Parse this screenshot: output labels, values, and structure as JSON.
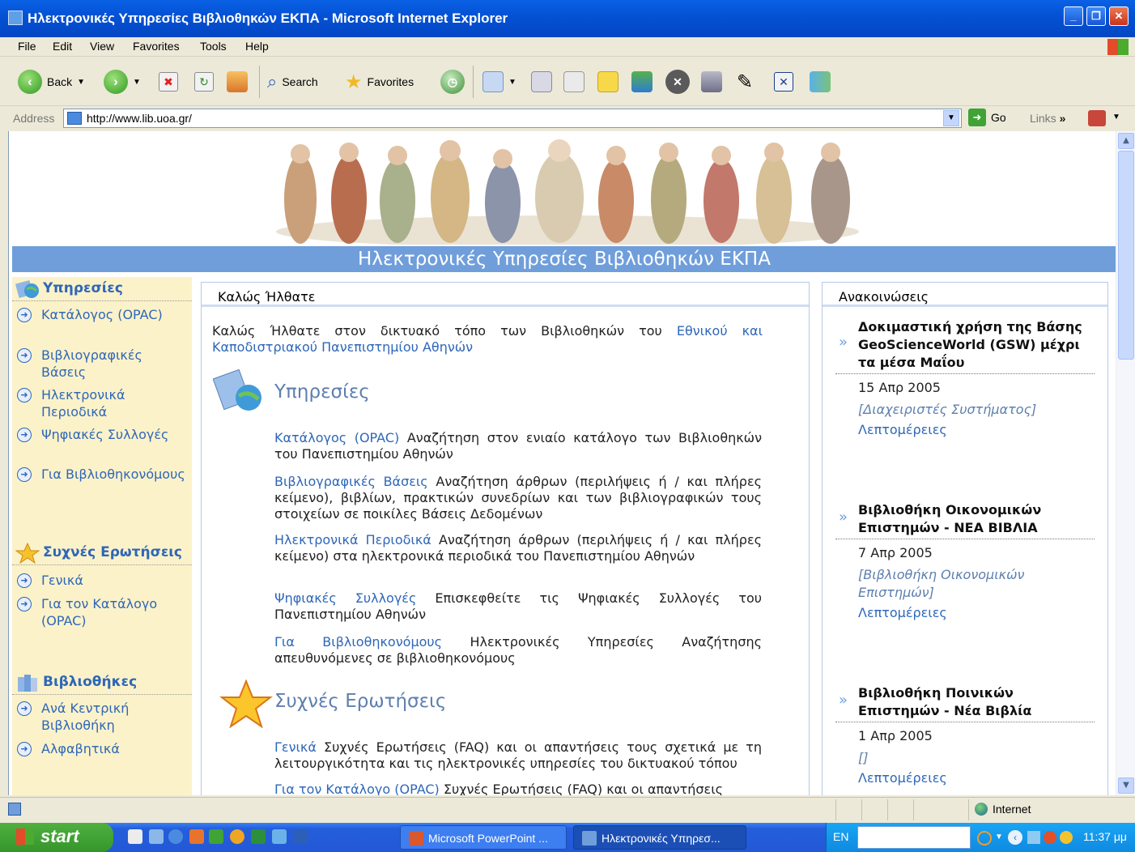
{
  "window": {
    "title": "Ηλεκτρονικές Υπηρεσίες Βιβλιοθηκών ΕΚΠΑ - Microsoft Internet Explorer"
  },
  "menu": [
    "File",
    "Edit",
    "View",
    "Favorites",
    "Tools",
    "Help"
  ],
  "toolbar": {
    "back": "Back",
    "search": "Search",
    "favorites": "Favorites"
  },
  "address": {
    "label": "Address",
    "url": "http://www.lib.uoa.gr/",
    "go": "Go",
    "links": "Links"
  },
  "page": {
    "banner_title": "Ηλεκτρονικές Υπηρεσίες Βιβλιοθηκών ΕΚΠΑ",
    "left_nav": {
      "sections": [
        {
          "title": "Υπηρεσίες",
          "icon": "globe-icon",
          "items": [
            "Κατάλογος (OPAC)",
            "Βιβλιογραφικές Βάσεις",
            "Ηλεκτρονικά Περιοδικά",
            "Ψηφιακές Συλλογές",
            "Για Βιβλιοθηκονόμους"
          ]
        },
        {
          "title": "Συχνές Ερωτήσεις",
          "icon": "star-icon",
          "items": [
            "Γενικά",
            "Για τον Κατάλογο (OPAC)"
          ]
        },
        {
          "title": "Βιβλιοθήκες",
          "icon": "books-icon",
          "items": [
            "Ανά Κεντρική Βιβλιοθήκη",
            "Αλφαβητικά"
          ]
        }
      ]
    },
    "main": {
      "header": "Καλώς Ήλθατε",
      "welcome_prefix": "Καλώς Ήλθατε στον δικτυακό τόπο των Βιβλιοθηκών του ",
      "welcome_link": "Εθνικού και Καποδιστριακού Πανεπιστημίου Αθηνών",
      "services_heading": "Υπηρεσίες",
      "services": [
        {
          "link": "Κατάλογος (OPAC)",
          "text": " Αναζήτηση στον ενιαίο κατάλογο των Βιβλιοθηκών του Πανεπιστημίου Αθηνών"
        },
        {
          "link": "Βιβλιογραφικές Βάσεις",
          "text": " Αναζήτηση άρθρων (περιλήψεις ή / και πλήρες κείμενο), βιβλίων, πρακτικών συνεδρίων και των βιβλιογραφικών τους στοιχείων σε ποικίλες Βάσεις Δεδομένων"
        },
        {
          "link": "Ηλεκτρονικά Περιοδικά",
          "text": " Αναζήτηση άρθρων (περιλήψεις ή / και πλήρες κείμενο) στα ηλεκτρονικά περιοδικά του Πανεπιστημίου Αθηνών"
        },
        {
          "link": "Ψηφιακές Συλλογές",
          "text": " Επισκεφθείτε τις Ψηφιακές Συλλογές του Πανεπιστημίου Αθηνών"
        },
        {
          "link": "Για Βιβλιοθηκονόμους",
          "text": " Ηλεκτρονικές Υπηρεσίες Αναζήτησης απευθυνόμενες σε βιβλιοθηκονόμους"
        }
      ],
      "faq_heading": "Συχνές Ερωτήσεις",
      "faq": [
        {
          "link": "Γενικά",
          "text": " Συχνές Ερωτήσεις (FAQ) και οι απαντήσεις τους σχετικά με τη λειτουργικότητα και τις ηλεκτρονικές υπηρεσίες του δικτυακού τόπου"
        },
        {
          "link": "Για τον Κατάλογο (OPAC)",
          "text": " Συχνές Ερωτήσεις (FAQ) και οι απαντήσεις"
        }
      ]
    },
    "announcements": {
      "header": "Ανακοινώσεις",
      "items": [
        {
          "title": "Δοκιμαστική χρήση της Βάσης GeoScienceWorld (GSW) μέχρι τα μέσα Μαΐου",
          "date": "15 Απρ 2005",
          "source": "[Διαχειριστές Συστήματος]",
          "more": "Λεπτομέρειες"
        },
        {
          "title": "Βιβλιοθήκη Οικονομικών Επιστημών - ΝΕΑ ΒΙΒΛΙΑ",
          "date": "7 Απρ 2005",
          "source": "[Βιβλιοθήκη Οικονομικών Επιστημών]",
          "more": "Λεπτομέρειες"
        },
        {
          "title": "Βιβλιοθήκη Ποινικών Επιστημών - Νέα Βιβλία",
          "date": "1 Απρ 2005",
          "source": "[]",
          "more": "Λεπτομέρειες"
        }
      ]
    }
  },
  "status": {
    "zone": "Internet"
  },
  "taskbar": {
    "start": "start",
    "buttons": [
      "Microsoft PowerPoint ...",
      "Ηλεκτρονικές Υπηρεσ..."
    ],
    "lang": "EN",
    "clock": "11:37 μμ"
  }
}
